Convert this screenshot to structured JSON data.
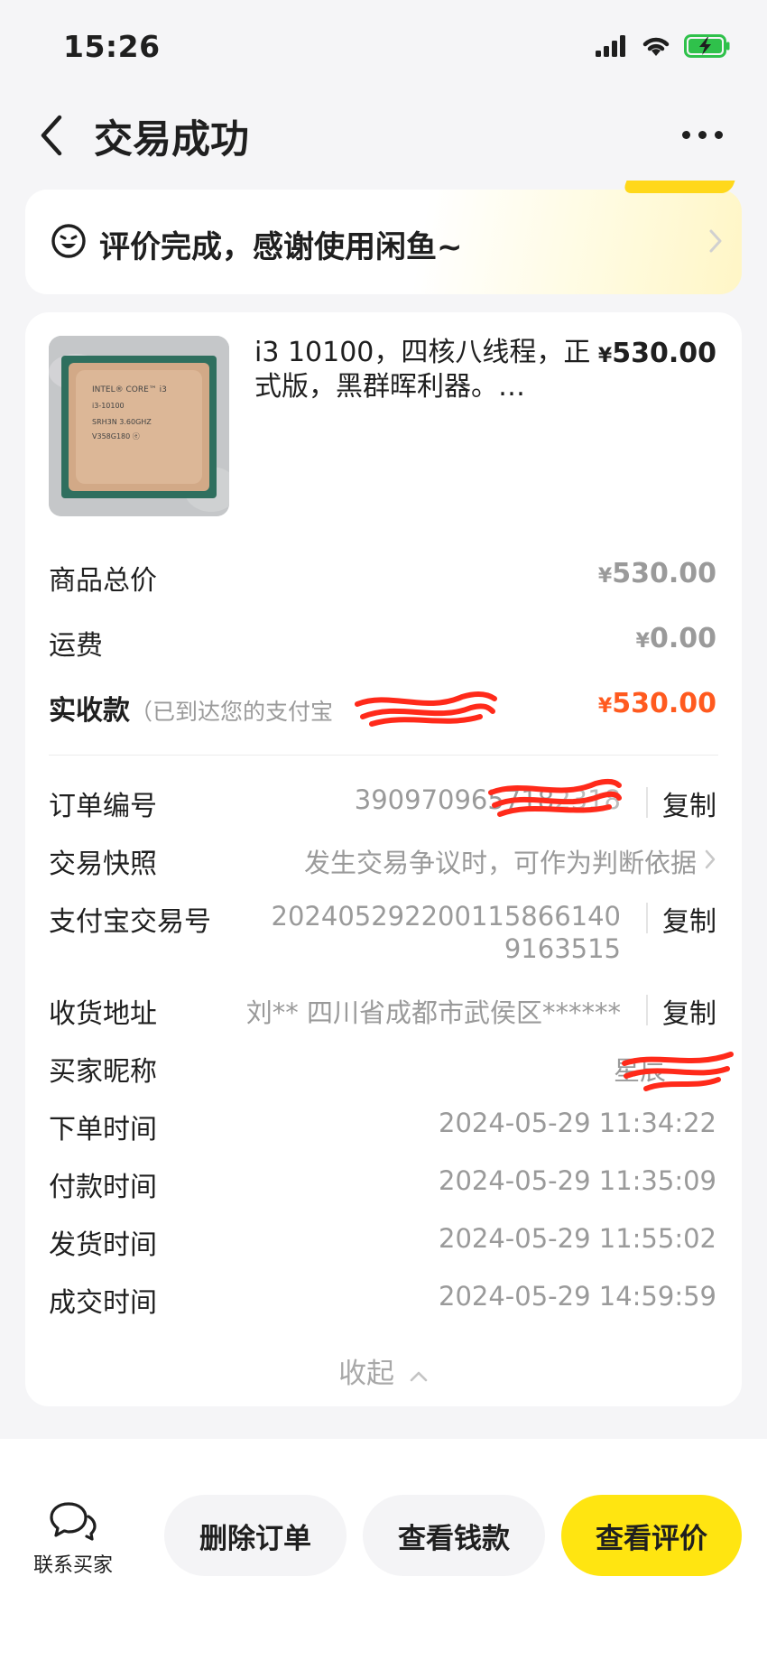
{
  "status_bar": {
    "time": "15:26"
  },
  "nav": {
    "title": "交易成功"
  },
  "banner": {
    "text": "评价完成，感谢使用闲鱼~"
  },
  "product": {
    "title": "i3 10100，四核八线程，正式版，黑群晖利器。…",
    "price_symbol": "¥",
    "price": "530.00",
    "chip_text_1": "INTEL® CORE™ i3",
    "chip_text_2": "i3-10100",
    "chip_text_3": "SRH3N 3.60GHZ",
    "chip_text_4": "V358G180 ⓔ"
  },
  "pricing": {
    "total_label": "商品总价",
    "total_value": "530.00",
    "shipping_label": "运费",
    "shipping_value": "0.00",
    "received_label": "实收款",
    "received_note": "（已到达您的支付宝",
    "received_value": "530.00",
    "symbol": "¥"
  },
  "details": {
    "order_no_label": "订单编号",
    "order_no_value": "390970965718",
    "order_no_tail": "2318",
    "snapshot_label": "交易快照",
    "snapshot_value": "发生交易争议时，可作为判断依据",
    "alipay_label": "支付宝交易号",
    "alipay_value_line1": "20240529220011586614​0",
    "alipay_value_line2": "9163515",
    "address_label": "收货地址",
    "address_value": "刘** 四川省成都市武侯区******",
    "buyer_label": "买家昵称",
    "buyer_value": "星辰",
    "order_time_label": "下单时间",
    "order_time_value": "2024-05-29 11:34:22",
    "pay_time_label": "付款时间",
    "pay_time_value": "2024-05-29 11:35:09",
    "ship_time_label": "发货时间",
    "ship_time_value": "2024-05-29 11:55:02",
    "deal_time_label": "成交时间",
    "deal_time_value": "2024-05-29 14:59:59",
    "copy_label": "复制",
    "collapse_label": "收起"
  },
  "bottom": {
    "contact_label": "联系买家",
    "delete_label": "删除订单",
    "funds_label": "查看钱款",
    "review_label": "查看评价"
  },
  "colors": {
    "accent_yellow": "#ffe511",
    "price_orange": "#ff5a1f",
    "redaction_red": "#ff2a1a"
  }
}
